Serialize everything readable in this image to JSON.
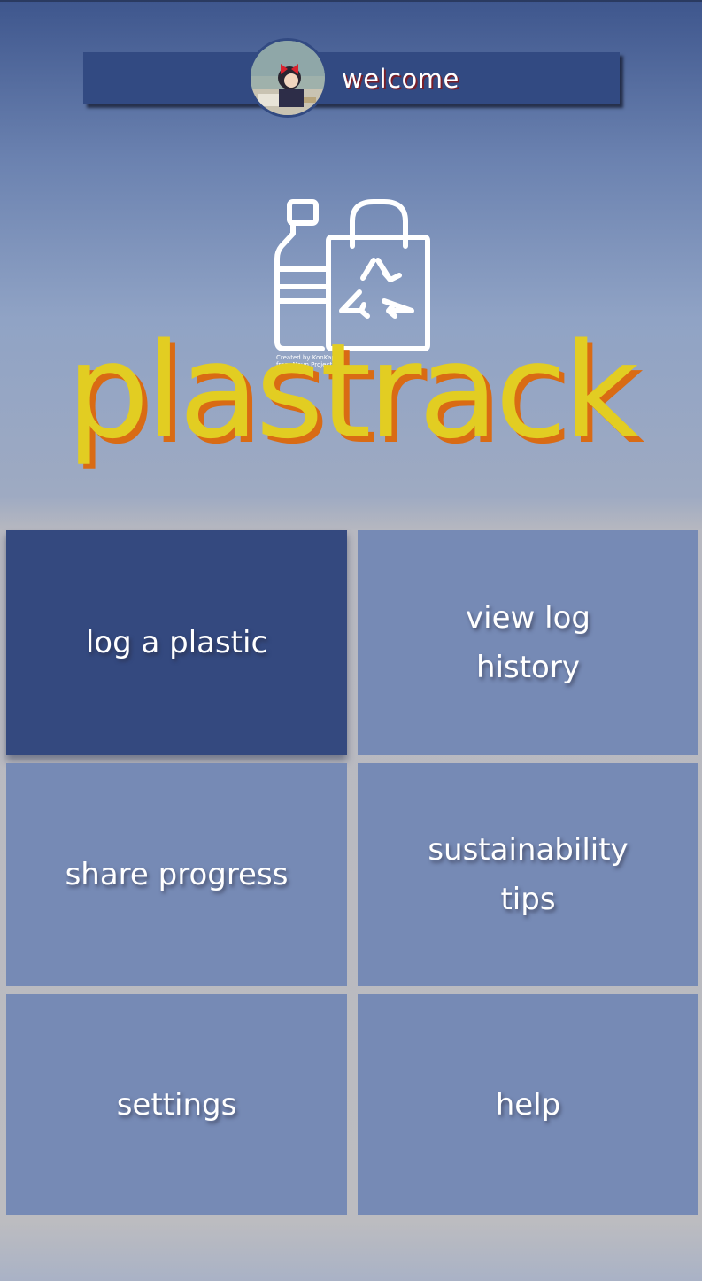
{
  "header": {
    "welcome_text": "welcome",
    "avatar": "user-avatar"
  },
  "logo": {
    "icon": "recycle-bottle-bag-icon",
    "credit_line1": "Created by KonKapp",
    "credit_line2": "from Noun Project"
  },
  "brand": {
    "name": "plastrack"
  },
  "menu": {
    "log_plastic": "log a plastic",
    "view_log_history": "view log history",
    "share_progress": "share progress",
    "sustainability_tips": "sustainability tips",
    "settings": "settings",
    "help": "help"
  },
  "colors": {
    "header_bar": "#324a82",
    "active_tile": "#34497f",
    "tile": "#768ab5",
    "brand_text": "#e2cd22",
    "brand_shadow": "#d96b14"
  }
}
